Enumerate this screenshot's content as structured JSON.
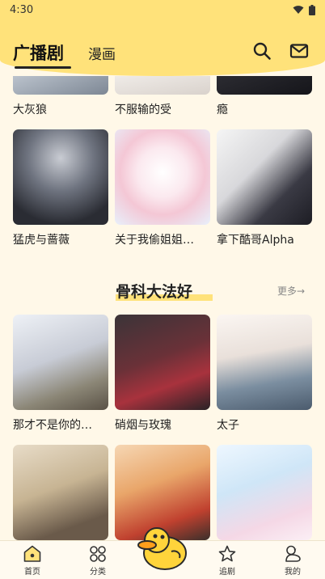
{
  "status": {
    "time": "4:30"
  },
  "header": {
    "tab_active": "广播剧",
    "tab_second": "漫画"
  },
  "top_row": [
    {
      "title": "大灰狼"
    },
    {
      "title": "不服输的受"
    },
    {
      "title": "瘾"
    }
  ],
  "row_one": [
    {
      "title": "猛虎与蔷薇"
    },
    {
      "title": "关于我偷姐姐…"
    },
    {
      "title": "拿下酷哥Alpha"
    }
  ],
  "section": {
    "title": "骨科大法好",
    "more": "更多→"
  },
  "row_two": [
    {
      "title": "那才不是你的…"
    },
    {
      "title": "硝烟与玫瑰"
    },
    {
      "title": "太子"
    }
  ],
  "bottom_nav": [
    {
      "label": "首页",
      "icon": "home-icon",
      "active": true
    },
    {
      "label": "分类",
      "icon": "category-icon",
      "active": false
    },
    {
      "label": "追剧",
      "icon": "star-icon",
      "active": false
    },
    {
      "label": "我的",
      "icon": "profile-icon",
      "active": false
    }
  ],
  "colors": {
    "accent": "#ffe27a",
    "background": "#fff8e8"
  }
}
